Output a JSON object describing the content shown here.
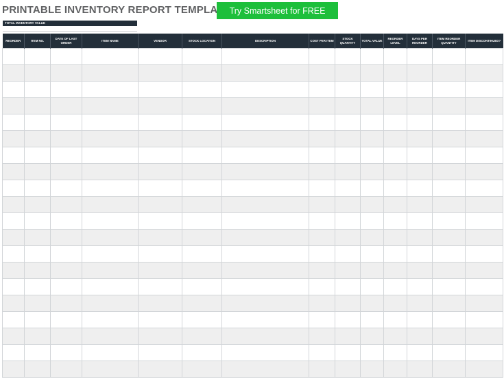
{
  "header": {
    "title": "PRINTABLE INVENTORY REPORT TEMPLATE",
    "cta_label": "Try Smartsheet for FREE"
  },
  "summary": {
    "total_inventory_label": "TOTAL INVENTORY VALUE",
    "total_inventory_value": ""
  },
  "table": {
    "columns": [
      "REORDER",
      "ITEM NO.",
      "DATE OF LAST ORDER",
      "ITEM NAME",
      "VENDOR",
      "STOCK LOCATION",
      "DESCRIPTION",
      "COST PER ITEM",
      "STOCK QUANTITY",
      "TOTAL VALUE",
      "REORDER LEVEL",
      "DAYS PER REORDER",
      "ITEM REORDER QUANTITY",
      "ITEM DISCONTINUED?"
    ],
    "empty_row_count": 20
  },
  "colors": {
    "header_bg": "#232f3a",
    "cta_bg": "#1dbf3b",
    "title_text": "#5f6062",
    "stripe": "#efefef"
  }
}
